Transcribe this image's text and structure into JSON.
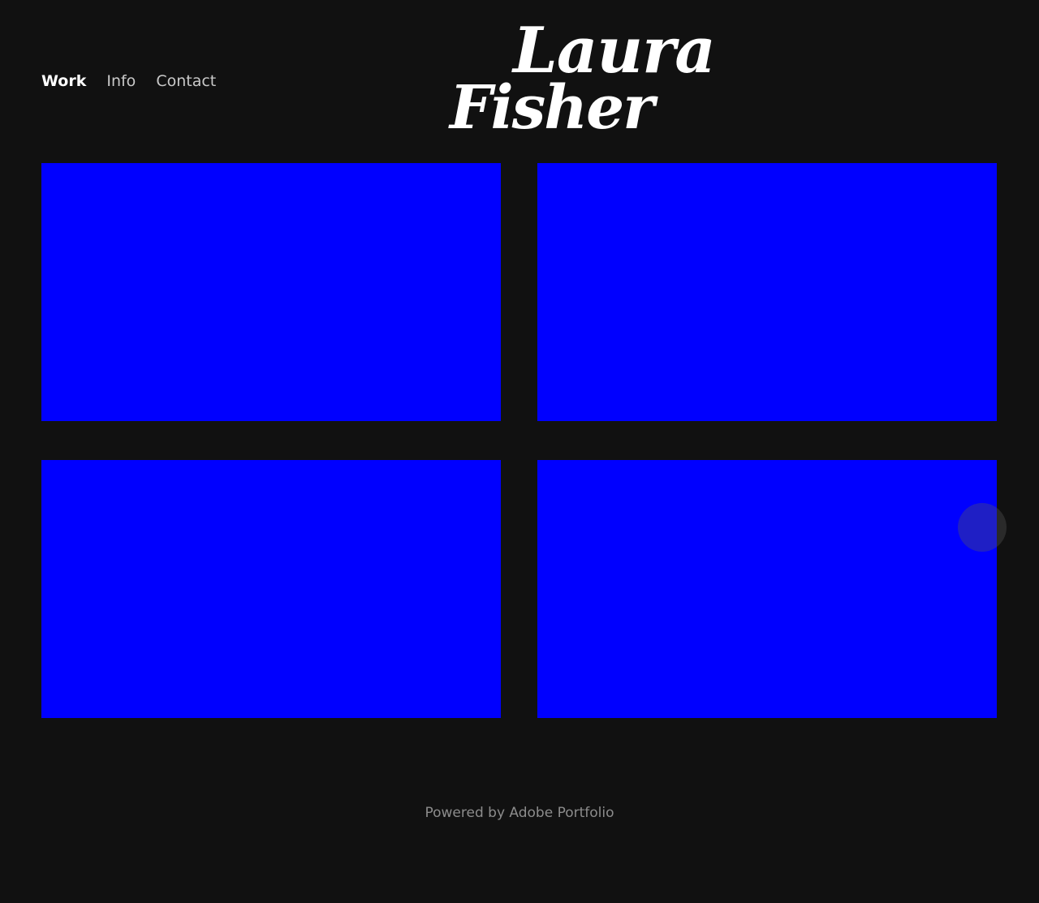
{
  "nav": {
    "items": [
      {
        "label": "Work",
        "active": true
      },
      {
        "label": "Info",
        "active": false
      },
      {
        "label": "Contact",
        "active": false
      }
    ]
  },
  "logo": {
    "line1": "Laura",
    "line2": "Fisher"
  },
  "projects": {
    "tile_color": "#0000ff",
    "count": 4
  },
  "footer": {
    "text": "Powered by Adobe Portfolio"
  },
  "colors": {
    "background": "#111111",
    "text": "#ffffff",
    "muted": "#8c8c8c"
  }
}
